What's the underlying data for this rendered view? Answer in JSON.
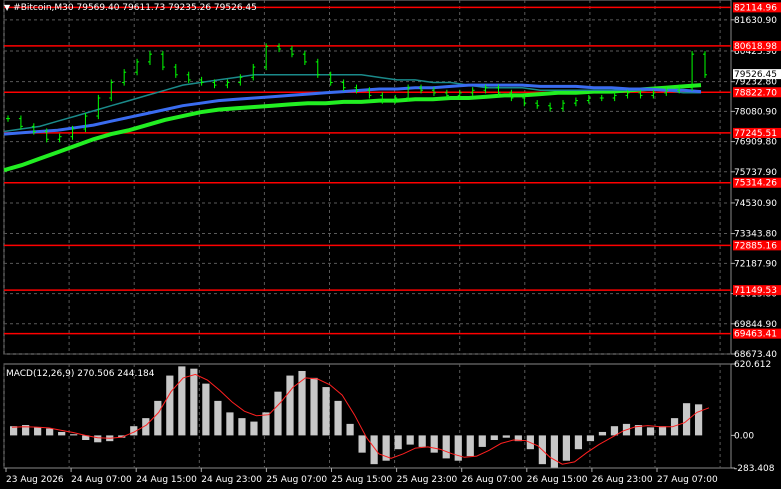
{
  "header": {
    "arrow": "▼",
    "text": "#Bitcoin,M30  79569.40 79611.73 79235.26 79526.45"
  },
  "colors": {
    "background": "#000000",
    "grid": "#5a5a5a",
    "candle": "#00ff00",
    "level_line": "#ff0000",
    "level_label_bg": "#ff0000",
    "ma_fast": "#1a8a8a",
    "ma_mid": "#3a6cf0",
    "ma_slow": "#22ee22",
    "macd_hist": "#c8c8c8",
    "macd_signal": "#ff2020",
    "price_label_bg": "#ffffff"
  },
  "price_axis": {
    "ticks": [
      "81630.90",
      "80423.90",
      "79232.80",
      "78080.90",
      "76909.80",
      "75737.90",
      "74530.90",
      "73343.80",
      "72187.90",
      "71015.80",
      "69844.90",
      "68673.40"
    ]
  },
  "levels": [
    "82114.96",
    "80618.98",
    "78822.70",
    "77245.51",
    "75314.26",
    "72885.16",
    "71149.53",
    "69463.41"
  ],
  "current_price": "79526.45",
  "macd": {
    "label": "MACD(12,26,9) 270.506 244.184",
    "axis": [
      "620.612",
      "0.00",
      "-283.408"
    ]
  },
  "time_axis": [
    "23 Aug 2026",
    "24 Aug 07:00",
    "24 Aug 15:00",
    "24 Aug 23:00",
    "25 Aug 07:00",
    "25 Aug 15:00",
    "25 Aug 23:00",
    "26 Aug 07:00",
    "26 Aug 15:00",
    "26 Aug 23:00",
    "27 Aug 07:00"
  ],
  "chart_data": {
    "type": "line",
    "title": "#Bitcoin,M30",
    "close": [
      77800,
      77500,
      77300,
      77000,
      77100,
      77400,
      77900,
      78600,
      79200,
      79600,
      80000,
      80300,
      79800,
      79500,
      79300,
      79200,
      79100,
      79200,
      79400,
      79800,
      80600,
      80500,
      80300,
      80000,
      79500,
      79200,
      79000,
      78900,
      78700,
      78500,
      78600,
      79000,
      78900,
      78800,
      78700,
      78800,
      78900,
      79000,
      78800,
      78600,
      78400,
      78300,
      78200,
      78400,
      78500,
      78600,
      78600,
      78700,
      78800,
      78700,
      78800,
      78900,
      79000,
      80300,
      79500
    ],
    "ma_fast": [
      77300,
      77400,
      77500,
      77700,
      77900,
      78100,
      78300,
      78500,
      78700,
      78900,
      79100,
      79200,
      79300,
      79400,
      79500,
      79500,
      79500,
      79500,
      79500,
      79500,
      79500,
      79400,
      79300,
      79300,
      79200,
      79200,
      79100,
      79000,
      79000,
      79000,
      78900,
      78900,
      78900,
      78900,
      78900,
      78900,
      78900,
      78900,
      78800,
      78800
    ],
    "ma_mid": [
      77200,
      77250,
      77300,
      77350,
      77450,
      77550,
      77700,
      77850,
      78000,
      78150,
      78300,
      78400,
      78500,
      78550,
      78600,
      78650,
      78700,
      78750,
      78800,
      78850,
      78900,
      78950,
      78950,
      79000,
      79000,
      79050,
      79100,
      79100,
      79100,
      79100,
      79050,
      79050,
      79050,
      79000,
      79000,
      78950,
      78950,
      78900,
      78900,
      78850
    ],
    "ma_slow": [
      75800,
      76000,
      76250,
      76500,
      76750,
      77000,
      77200,
      77350,
      77550,
      77750,
      77900,
      78050,
      78150,
      78200,
      78250,
      78300,
      78350,
      78400,
      78400,
      78450,
      78450,
      78500,
      78500,
      78550,
      78550,
      78600,
      78600,
      78650,
      78700,
      78700,
      78750,
      78800,
      78800,
      78850,
      78850,
      78900,
      78950,
      79000,
      79050,
      79100
    ],
    "macd_histogram": [
      80,
      90,
      70,
      60,
      30,
      10,
      -40,
      -60,
      -50,
      -20,
      80,
      150,
      300,
      520,
      600,
      580,
      450,
      300,
      200,
      150,
      120,
      200,
      380,
      520,
      560,
      500,
      420,
      300,
      100,
      -150,
      -250,
      -220,
      -120,
      -80,
      -100,
      -150,
      -200,
      -220,
      -180,
      -100,
      -40,
      -20,
      -50,
      -120,
      -250,
      -280,
      -220,
      -120,
      -50,
      30,
      80,
      100,
      90,
      70,
      80,
      150,
      280,
      270
    ],
    "macd_signal": [
      70,
      75,
      72,
      65,
      45,
      25,
      0,
      -20,
      -25,
      -15,
      30,
      90,
      200,
      380,
      500,
      530,
      480,
      390,
      290,
      210,
      170,
      180,
      290,
      420,
      500,
      490,
      440,
      350,
      180,
      -20,
      -160,
      -200,
      -160,
      -110,
      -100,
      -120,
      -160,
      -190,
      -180,
      -130,
      -70,
      -40,
      -45,
      -90,
      -190,
      -250,
      -230,
      -150,
      -80,
      -20,
      40,
      75,
      85,
      75,
      75,
      110,
      200,
      240
    ],
    "ylim": [
      68673.4,
      82400
    ],
    "macd_ylim": [
      -283.408,
      620.612
    ],
    "x_ticks": [
      "23 Aug 2026",
      "24 Aug 07:00",
      "24 Aug 15:00",
      "24 Aug 23:00",
      "25 Aug 07:00",
      "25 Aug 15:00",
      "25 Aug 23:00",
      "26 Aug 07:00",
      "26 Aug 15:00",
      "26 Aug 23:00",
      "27 Aug 07:00"
    ],
    "grid": true
  }
}
